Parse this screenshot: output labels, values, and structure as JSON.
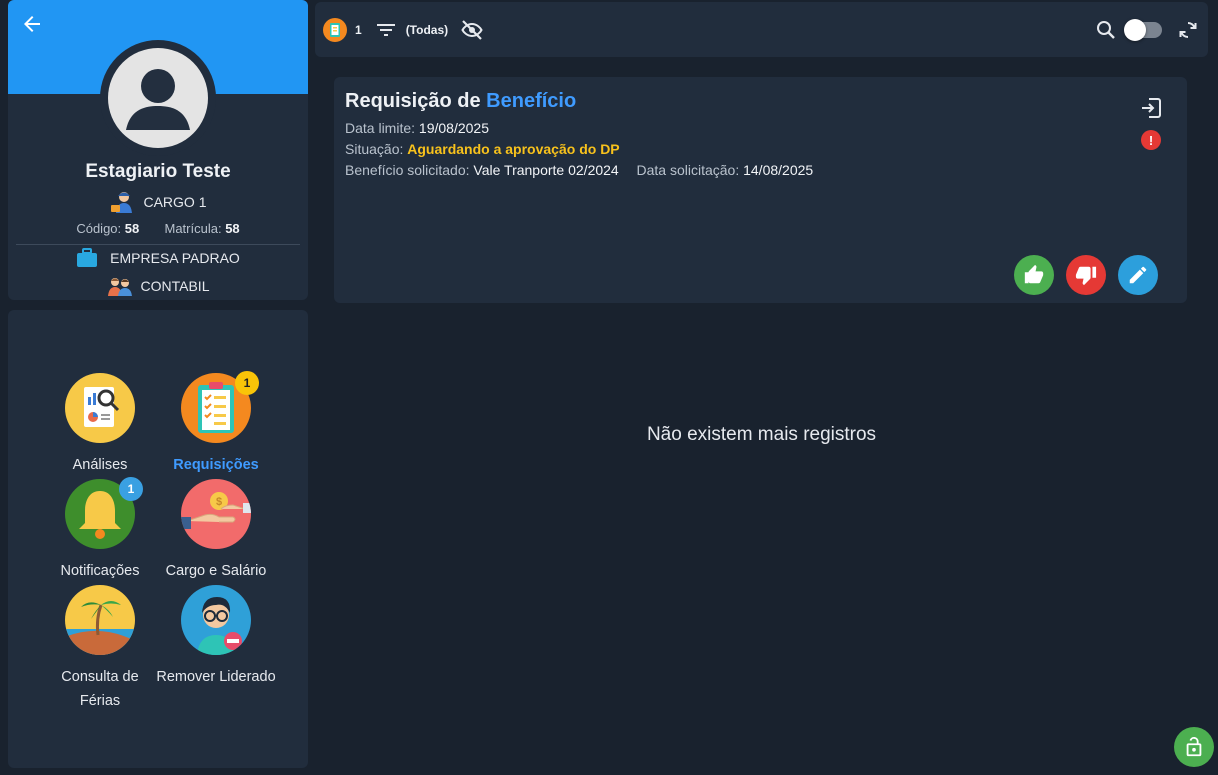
{
  "profile": {
    "name": "Estagiario Teste",
    "cargo": "CARGO 1",
    "codigo_label": "Código:",
    "codigo_value": "58",
    "matricula_label": "Matrícula:",
    "matricula_value": "58",
    "empresa": "EMPRESA PADRAO",
    "setor": "CONTABIL"
  },
  "menu": {
    "items": [
      {
        "label": "Análises",
        "icon": "analytics-icon"
      },
      {
        "label": "Requisições",
        "icon": "clipboard-checklist-icon",
        "badge": "1",
        "active": true
      },
      {
        "label": "Notificações",
        "icon": "bell-icon",
        "badge": "1"
      },
      {
        "label": "Cargo e Salário",
        "icon": "salary-hand-icon"
      },
      {
        "label": "Consulta de Férias",
        "icon": "beach-icon"
      },
      {
        "label": "Remover Liderado",
        "icon": "remove-person-icon"
      }
    ]
  },
  "toolbar": {
    "count": "1",
    "filter_label": "(Todas)"
  },
  "request": {
    "title_prefix": "Requisição de",
    "title_accent": "Benefício",
    "deadline_label": "Data limite:",
    "deadline_value": "19/08/2025",
    "status_label": "Situação:",
    "status_value": "Aguardando a aprovação do DP",
    "benefit_label": "Benefício solicitado:",
    "benefit_value": "Vale Tranporte 02/2024",
    "request_date_label": "Data solicitação:",
    "request_date_value": "14/08/2025",
    "alert_symbol": "!"
  },
  "empty_message": "Não existem mais registros",
  "colors": {
    "accent": "#2196f3",
    "status": "#f8c21c",
    "approve": "#4caf50",
    "reject": "#e53935",
    "edit": "#2c9fdc"
  }
}
